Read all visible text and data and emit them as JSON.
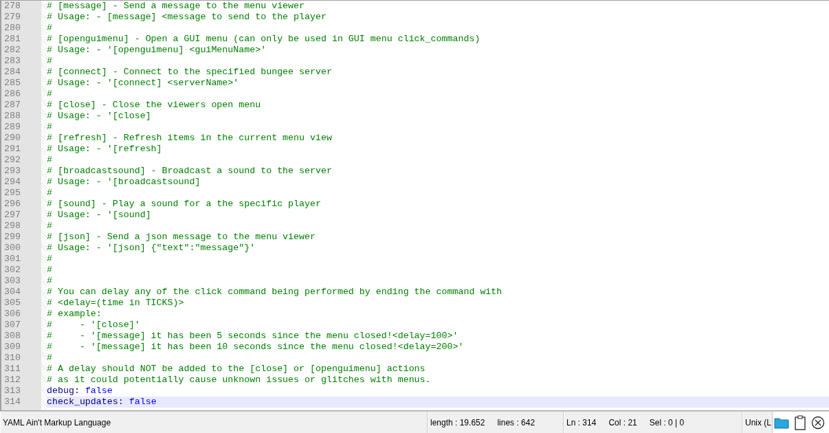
{
  "editor": {
    "lines": [
      {
        "number": "278",
        "kind": "comment",
        "text": "# [message] - Send a message to the menu viewer",
        "selected": false
      },
      {
        "number": "279",
        "kind": "comment",
        "text": "# Usage: - [message] <message to send to the player",
        "selected": false
      },
      {
        "number": "280",
        "kind": "comment",
        "text": "#",
        "selected": false
      },
      {
        "number": "281",
        "kind": "comment",
        "text": "# [openguimenu] - Open a GUI menu (can only be used in GUI menu click_commands)",
        "selected": false
      },
      {
        "number": "282",
        "kind": "comment",
        "text": "# Usage: - '[openguimenu] <guiMenuName>'",
        "selected": false
      },
      {
        "number": "283",
        "kind": "comment",
        "text": "#",
        "selected": false
      },
      {
        "number": "284",
        "kind": "comment",
        "text": "# [connect] - Connect to the specified bungee server",
        "selected": false
      },
      {
        "number": "285",
        "kind": "comment",
        "text": "# Usage: - '[connect] <serverName>'",
        "selected": false
      },
      {
        "number": "286",
        "kind": "comment",
        "text": "#",
        "selected": false
      },
      {
        "number": "287",
        "kind": "comment",
        "text": "# [close] - Close the viewers open menu",
        "selected": false
      },
      {
        "number": "288",
        "kind": "comment",
        "text": "# Usage: - '[close]",
        "selected": false
      },
      {
        "number": "289",
        "kind": "comment",
        "text": "#",
        "selected": false
      },
      {
        "number": "290",
        "kind": "comment",
        "text": "# [refresh] - Refresh items in the current menu view",
        "selected": false
      },
      {
        "number": "291",
        "kind": "comment",
        "text": "# Usage: - '[refresh]",
        "selected": false
      },
      {
        "number": "292",
        "kind": "comment",
        "text": "#",
        "selected": false
      },
      {
        "number": "293",
        "kind": "comment",
        "text": "# [broadcastsound] - Broadcast a sound to the server",
        "selected": false
      },
      {
        "number": "294",
        "kind": "comment",
        "text": "# Usage: - '[broadcastsound]",
        "selected": false
      },
      {
        "number": "295",
        "kind": "comment",
        "text": "#",
        "selected": false
      },
      {
        "number": "296",
        "kind": "comment",
        "text": "# [sound] - Play a sound for a the specific player",
        "selected": false
      },
      {
        "number": "297",
        "kind": "comment",
        "text": "# Usage: - '[sound]",
        "selected": false
      },
      {
        "number": "298",
        "kind": "comment",
        "text": "#",
        "selected": false
      },
      {
        "number": "299",
        "kind": "comment",
        "text": "# [json] - Send a json message to the menu viewer",
        "selected": false
      },
      {
        "number": "300",
        "kind": "comment",
        "text": "# Usage: - '[json] {\"text\":\"message\"}'",
        "selected": false
      },
      {
        "number": "301",
        "kind": "comment",
        "text": "#",
        "selected": false
      },
      {
        "number": "302",
        "kind": "comment",
        "text": "#",
        "selected": false
      },
      {
        "number": "303",
        "kind": "comment",
        "text": "#",
        "selected": false
      },
      {
        "number": "304",
        "kind": "comment",
        "text": "# You can delay any of the click command being performed by ending the command with",
        "selected": false
      },
      {
        "number": "305",
        "kind": "comment",
        "text": "# <delay=(time in TICKS)>",
        "selected": false
      },
      {
        "number": "306",
        "kind": "comment",
        "text": "# example:",
        "selected": false
      },
      {
        "number": "307",
        "kind": "comment",
        "text": "#     - '[close]'",
        "selected": false
      },
      {
        "number": "308",
        "kind": "comment",
        "text": "#     - '[message] it has been 5 seconds since the menu closed!<delay=100>'",
        "selected": false
      },
      {
        "number": "309",
        "kind": "comment",
        "text": "#     - '[message] it has been 10 seconds since the menu closed!<delay=200>'",
        "selected": false
      },
      {
        "number": "310",
        "kind": "comment",
        "text": "#",
        "selected": false
      },
      {
        "number": "311",
        "kind": "comment",
        "text": "# A delay should NOT be added to the [close] or [openguimenu] actions",
        "selected": false
      },
      {
        "number": "312",
        "kind": "comment",
        "text": "# as it could potentially cause unknown issues or glitches with menus.",
        "selected": false
      },
      {
        "number": "313",
        "kind": "pair",
        "key": "debug:",
        "value": "false",
        "selected": false
      },
      {
        "number": "314",
        "kind": "pair",
        "key": "check_updates:",
        "value": "false",
        "selected": true
      }
    ]
  },
  "status_bar": {
    "language": "YAML Ain't Markup Language",
    "length": "length : 19.652",
    "lines": "lines : 642",
    "ln": "Ln : 314",
    "col": "Col : 21",
    "sel": "Sel : 0 | 0",
    "eol": "Unix (L"
  }
}
